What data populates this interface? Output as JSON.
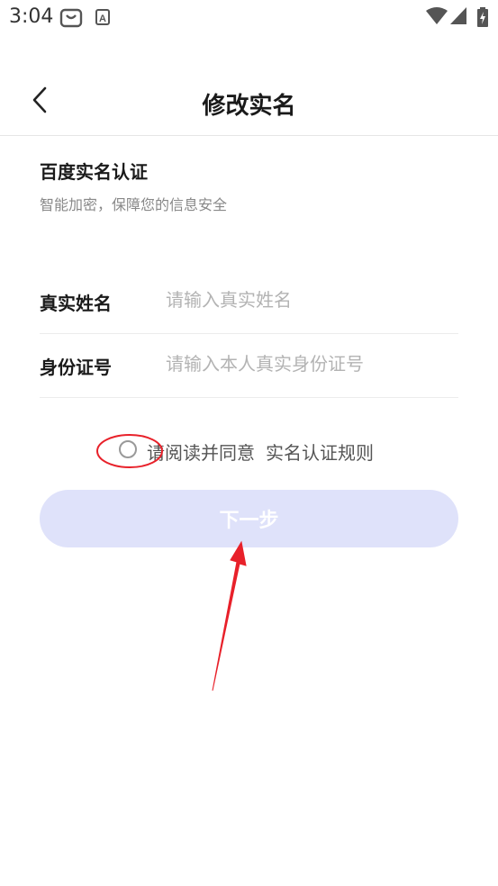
{
  "status_bar": {
    "time": "3:04",
    "icons": [
      "shop-bag-icon",
      "a-letter-icon",
      "wifi-icon",
      "signal-icon",
      "battery-icon"
    ]
  },
  "nav": {
    "back_icon": "chevron-left-icon",
    "title": "修改实名"
  },
  "section": {
    "title": "百度实名认证",
    "subtitle": "智能加密，保障您的信息安全"
  },
  "form": {
    "name": {
      "label": "真实姓名",
      "placeholder": "请输入真实姓名",
      "value": ""
    },
    "id_number": {
      "label": "身份证号",
      "placeholder": "请输入本人真实身份证号",
      "value": ""
    }
  },
  "agreement": {
    "checked": false,
    "text": "请阅读并同意",
    "link_text": "实名认证规则"
  },
  "next_button": {
    "label": "下一步",
    "enabled": false
  },
  "colors": {
    "button_disabled_bg": "#dfe2fa",
    "annotation_red": "#e8212a"
  }
}
